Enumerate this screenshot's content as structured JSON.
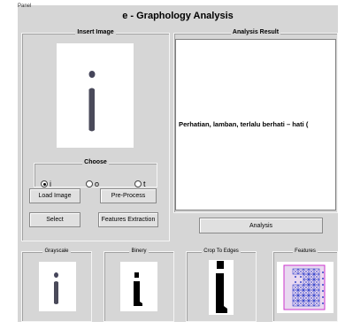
{
  "panel": {
    "label": "Panel"
  },
  "app": {
    "title": "e - Graphology Analysis"
  },
  "insert_image": {
    "title": "Insert Image"
  },
  "analysis_result": {
    "title": "Analysis Result",
    "text": "Perhatian, lamban, terlalu berhati – hati ("
  },
  "choose": {
    "title": "Choose",
    "options": [
      {
        "label": "i",
        "selected": true
      },
      {
        "label": "o",
        "selected": false
      },
      {
        "label": "t",
        "selected": false
      }
    ]
  },
  "buttons": {
    "load_image": "Load Image",
    "pre_process": "Pre-Process",
    "select": "Select",
    "features_extraction": "Features Extraction",
    "analysis": "Analysis"
  },
  "thumbnails": {
    "grayscale": "Grayscale",
    "binery": "Binery",
    "crop_to_edges": "Crop To Edges",
    "features": "Features"
  },
  "colors": {
    "panel_bg": "#d6d6d6",
    "ink_gray": "#4a4a5a",
    "features_frame": "#cc33cc",
    "features_grid": "#3344cc"
  }
}
